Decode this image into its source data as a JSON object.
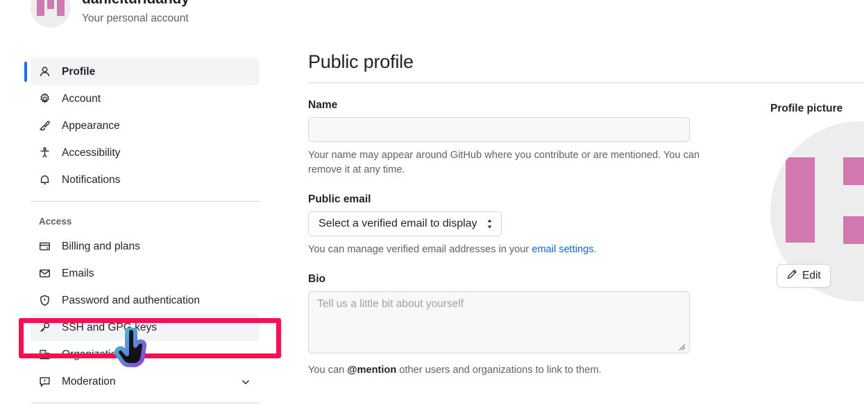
{
  "account": {
    "username": "danielturidandy",
    "subtitle": "Your personal account",
    "avatar_icon": "identicon-avatar"
  },
  "sidebar": {
    "primary_items": [
      {
        "label": "Profile",
        "icon": "person-icon",
        "active": true
      },
      {
        "label": "Account",
        "icon": "gear-icon",
        "active": false
      },
      {
        "label": "Appearance",
        "icon": "paintbrush-icon",
        "active": false
      },
      {
        "label": "Accessibility",
        "icon": "accessibility-icon",
        "active": false
      },
      {
        "label": "Notifications",
        "icon": "bell-icon",
        "active": false
      }
    ],
    "access_section_title": "Access",
    "access_items": [
      {
        "label": "Billing and plans",
        "icon": "credit-card-icon",
        "highlighted": false
      },
      {
        "label": "Emails",
        "icon": "mail-icon",
        "highlighted": false
      },
      {
        "label": "Password and authentication",
        "icon": "shield-lock-icon",
        "highlighted": false
      },
      {
        "label": "SSH and GPG keys",
        "icon": "key-icon",
        "highlighted": true
      },
      {
        "label": "Organizations",
        "icon": "organization-icon",
        "highlighted": false
      },
      {
        "label": "Moderation",
        "icon": "report-icon",
        "highlighted": false,
        "has_chevron": true
      }
    ]
  },
  "main": {
    "page_title": "Public profile",
    "name_field": {
      "label": "Name",
      "value": "",
      "placeholder": "",
      "help": "Your name may appear around GitHub where you contribute or are mentioned. You can remove it at any time."
    },
    "public_email": {
      "label": "Public email",
      "selected_option": "Select a verified email to display",
      "help_prefix": "You can manage verified email addresses in your ",
      "help_link": "email settings",
      "help_suffix": "."
    },
    "bio": {
      "label": "Bio",
      "value": "",
      "placeholder": "Tell us a little bit about yourself",
      "help_prefix": "You can ",
      "help_bold": "@mention",
      "help_suffix": " other users and organizations to link to them."
    }
  },
  "profile_picture": {
    "title": "Profile picture",
    "edit_label": "Edit",
    "edit_icon": "pencil-icon"
  },
  "colors": {
    "highlight_border": "#f5104f",
    "active_indicator": "#1f6feb",
    "link": "#0969da",
    "avatar_pink": "#d277b0",
    "avatar_bg": "#ededed"
  },
  "cursor": {
    "type": "pointing-hand-cursor"
  }
}
